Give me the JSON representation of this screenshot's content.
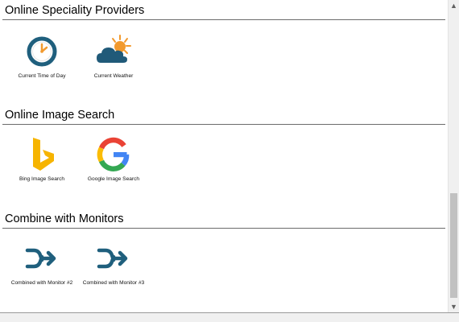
{
  "sections": [
    {
      "title": "Online Speciality Providers",
      "tiles": [
        {
          "label": "Current Time of Day",
          "icon": "clock-icon"
        },
        {
          "label": "Current Weather",
          "icon": "weather-icon"
        }
      ]
    },
    {
      "title": "Online Image Search",
      "tiles": [
        {
          "label": "Bing Image Search",
          "icon": "bing-icon"
        },
        {
          "label": "Google Image Search",
          "icon": "google-icon"
        }
      ]
    },
    {
      "title": "Combine with Monitors",
      "tiles": [
        {
          "label": "Combined with Monitor #2",
          "icon": "combine-icon"
        },
        {
          "label": "Combined with Monitor #3",
          "icon": "combine-icon"
        }
      ]
    }
  ],
  "colors": {
    "clock_ring": "#1f5f7d",
    "weather_cloud": "#205a79",
    "weather_sun": "#f29a2e",
    "bing": "#f6b400",
    "combine_arrow": "#1f5f7d"
  }
}
